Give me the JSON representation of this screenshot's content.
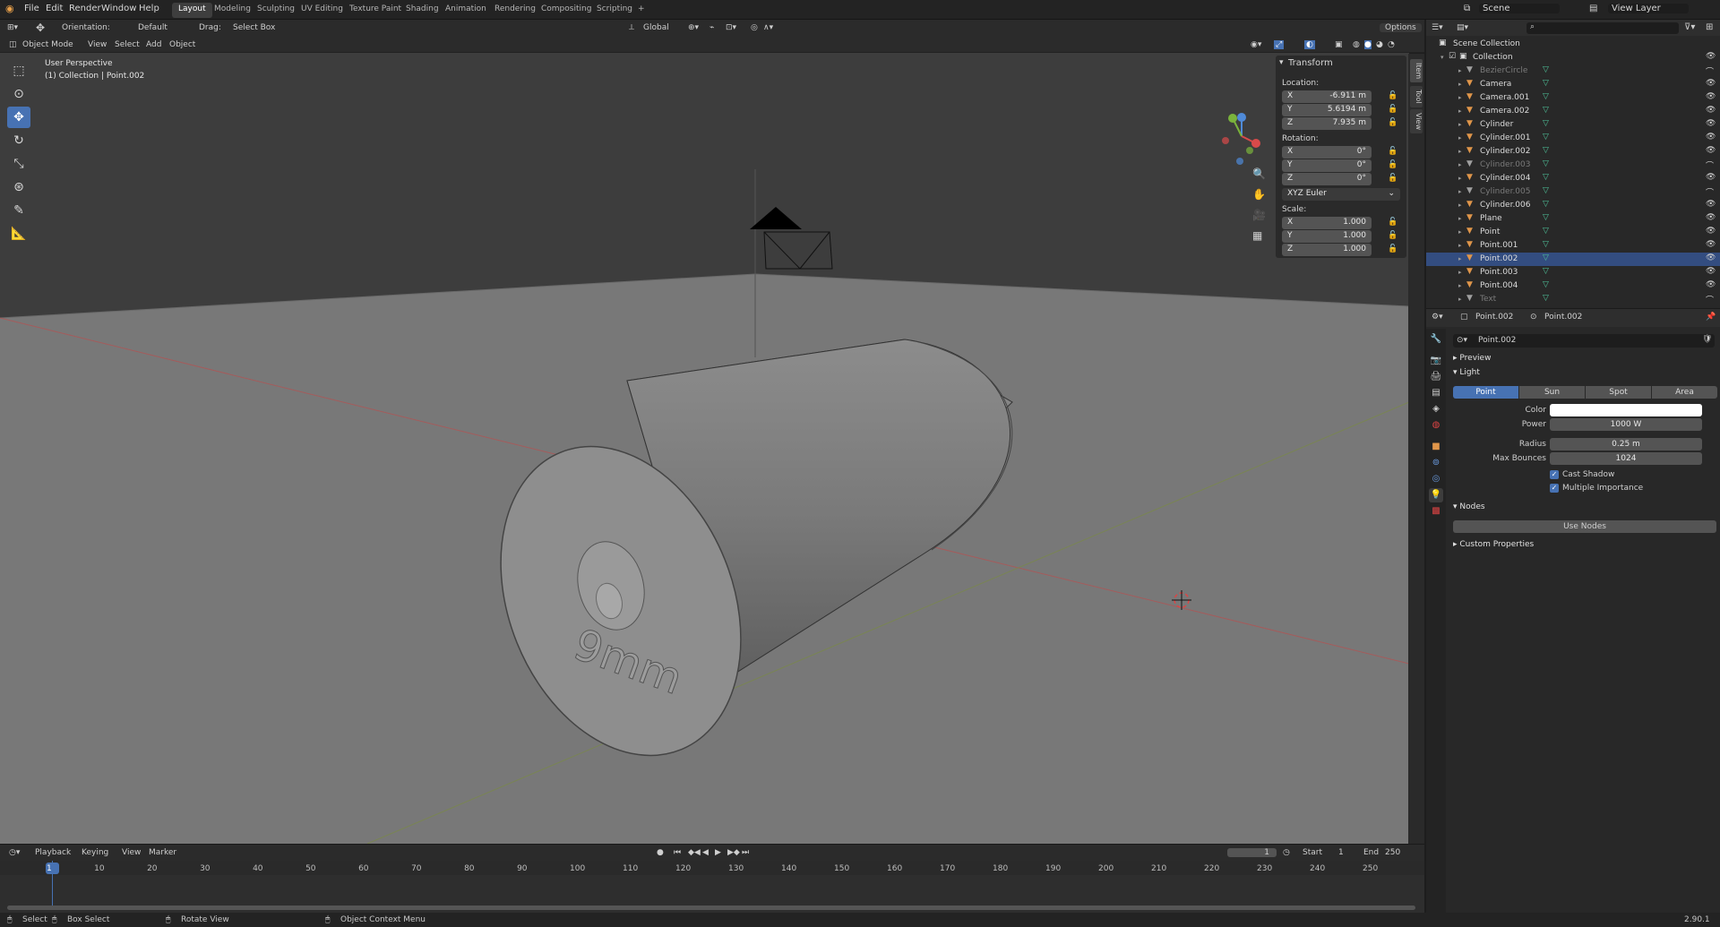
{
  "menu": {
    "items": [
      "File",
      "Edit",
      "Render",
      "Window",
      "Help"
    ],
    "workspaces": [
      "Layout",
      "Modeling",
      "Sculpting",
      "UV Editing",
      "Texture Paint",
      "Shading",
      "Animation",
      "Rendering",
      "Compositing",
      "Scripting"
    ],
    "active_workspace": "Layout",
    "add_tab": "+",
    "scene": "Scene",
    "view_layer": "View Layer"
  },
  "tool_header": {
    "orientation_label": "Orientation:",
    "orientation_value": "Default",
    "drag_label": "Drag:",
    "drag_value": "Select Box",
    "transform_orientation": "Global",
    "options": "Options"
  },
  "viewport_header": {
    "mode": "Object Mode",
    "menus": [
      "View",
      "Select",
      "Add",
      "Object"
    ]
  },
  "viewport": {
    "perspective": "User Perspective",
    "context": "(1) Collection | Point.002",
    "engraving": "9mm",
    "gizmo_x": "X",
    "gizmo_y": "Y",
    "gizmo_z": "Z"
  },
  "npanel": {
    "title": "Transform",
    "location_label": "Location:",
    "location": {
      "x": "-6.911 m",
      "y": "5.6194 m",
      "z": "7.935 m"
    },
    "rotation_label": "Rotation:",
    "rotation": {
      "x": "0°",
      "y": "0°",
      "z": "0°"
    },
    "rotation_mode": "XYZ Euler",
    "scale_label": "Scale:",
    "scale": {
      "x": "1.000",
      "y": "1.000",
      "z": "1.000"
    },
    "axis_x": "X",
    "axis_y": "Y",
    "axis_z": "Z",
    "tabs": [
      "Item",
      "Tool",
      "View"
    ]
  },
  "outliner": {
    "root": "Scene Collection",
    "collection": "Collection",
    "items": [
      {
        "name": "BezierCircle",
        "dim": true,
        "color": "#a0a0a0"
      },
      {
        "name": "Camera",
        "dim": false,
        "color": "#e0964a"
      },
      {
        "name": "Camera.001",
        "dim": false,
        "color": "#e0964a"
      },
      {
        "name": "Camera.002",
        "dim": false,
        "color": "#e0964a"
      },
      {
        "name": "Cylinder",
        "dim": false,
        "color": "#e0964a"
      },
      {
        "name": "Cylinder.001",
        "dim": false,
        "color": "#e0964a"
      },
      {
        "name": "Cylinder.002",
        "dim": false,
        "color": "#e0964a"
      },
      {
        "name": "Cylinder.003",
        "dim": true,
        "color": "#a0a0a0"
      },
      {
        "name": "Cylinder.004",
        "dim": false,
        "color": "#e0964a"
      },
      {
        "name": "Cylinder.005",
        "dim": true,
        "color": "#a0a0a0"
      },
      {
        "name": "Cylinder.006",
        "dim": false,
        "color": "#e0964a"
      },
      {
        "name": "Plane",
        "dim": false,
        "color": "#e0964a"
      },
      {
        "name": "Point",
        "dim": false,
        "color": "#e0964a"
      },
      {
        "name": "Point.001",
        "dim": false,
        "color": "#e0964a"
      },
      {
        "name": "Point.002",
        "dim": false,
        "color": "#e0964a",
        "selected": true
      },
      {
        "name": "Point.003",
        "dim": false,
        "color": "#e0964a"
      },
      {
        "name": "Point.004",
        "dim": false,
        "color": "#e0964a"
      },
      {
        "name": "Text",
        "dim": true,
        "color": "#a0a0a0"
      }
    ]
  },
  "properties": {
    "breadcrumb_object": "Point.002",
    "breadcrumb_data": "Point.002",
    "datablock_name": "Point.002",
    "preview": "Preview",
    "light": "Light",
    "light_types": [
      "Point",
      "Sun",
      "Spot",
      "Area"
    ],
    "active_light_type": "Point",
    "color_label": "Color",
    "color_value": "#ffffff",
    "power_label": "Power",
    "power_value": "1000 W",
    "radius_label": "Radius",
    "radius_value": "0.25 m",
    "bounces_label": "Max Bounces",
    "bounces_value": "1024",
    "cast_shadow": "Cast Shadow",
    "multiple_importance": "Multiple Importance",
    "nodes": "Nodes",
    "use_nodes": "Use Nodes",
    "custom_properties": "Custom Properties"
  },
  "timeline": {
    "menus": [
      "Playback",
      "Keying",
      "View",
      "Marker"
    ],
    "current_frame": "1",
    "start_label": "Start",
    "start": "1",
    "end_label": "End",
    "end": "250",
    "ticks": [
      "1",
      "10",
      "20",
      "30",
      "40",
      "50",
      "60",
      "70",
      "80",
      "90",
      "100",
      "110",
      "120",
      "130",
      "140",
      "150",
      "160",
      "170",
      "180",
      "190",
      "200",
      "210",
      "220",
      "230",
      "240",
      "250"
    ]
  },
  "statusbar": {
    "select": "Select",
    "box_select": "Box Select",
    "rotate_view": "Rotate View",
    "context_menu": "Object Context Menu",
    "version": "2.90.1"
  },
  "colors": {
    "accent": "#4772b3",
    "selected_row": "#334d80",
    "object_icon": "#e0964a",
    "data_icon": "#4fc39a"
  }
}
